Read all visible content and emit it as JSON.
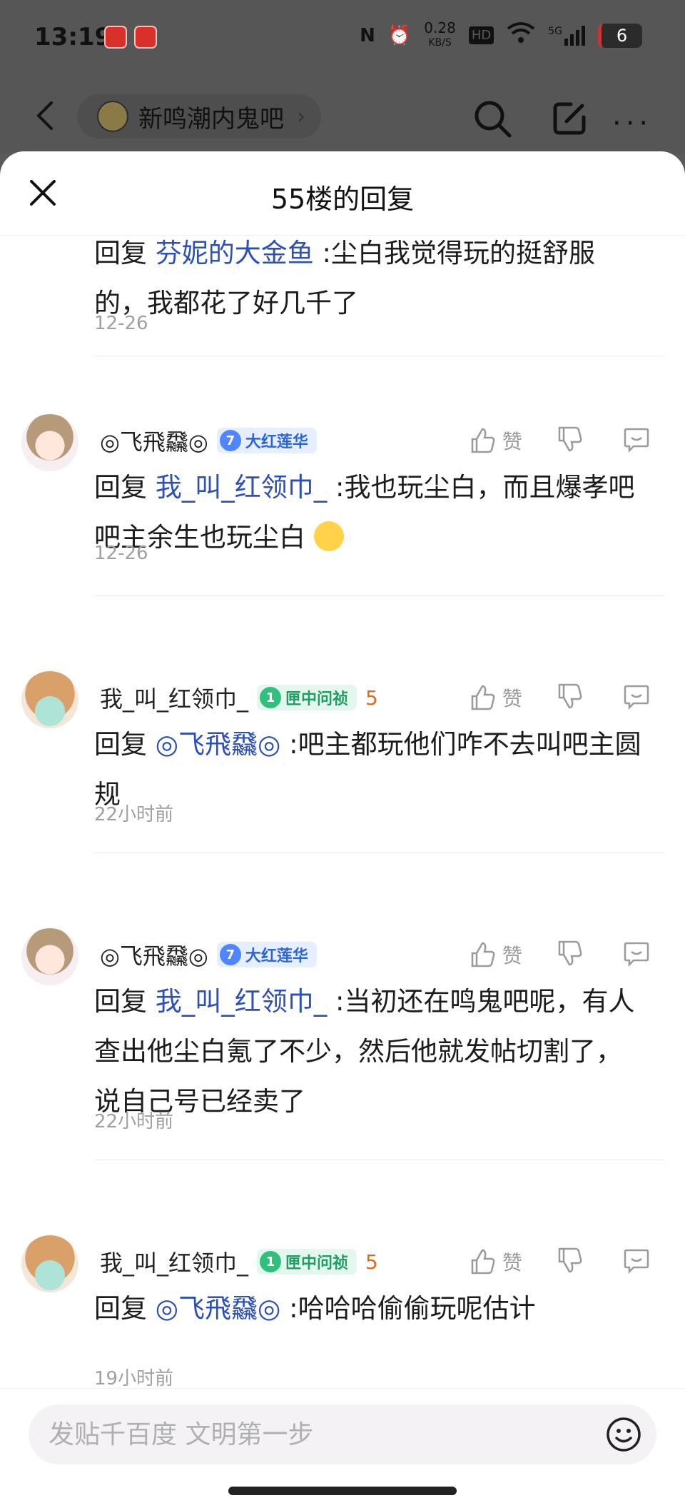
{
  "status_bar": {
    "time": "13:19",
    "net_speed": "0.28",
    "net_unit": "KB/S",
    "hd": "HD",
    "signal_label": "5G",
    "battery": "6"
  },
  "top_nav": {
    "forum_name": "新鸣潮内鬼吧"
  },
  "sheet": {
    "title": "55楼的回复"
  },
  "replies": [
    {
      "prefix": "回复",
      "mention": "芬妮的大金鱼",
      "text": " :尘白我觉得玩的挺舒服的，我都花了好几千了",
      "date": "12-26"
    },
    {
      "username": "◎飞飛飝◎",
      "badge_level": "7",
      "badge_title": "大红莲华",
      "like_label": "赞",
      "prefix": "回复",
      "mention": "我_叫_红领巾_",
      "text": " :我也玩尘白，而且爆孝吧吧主余生也玩尘白",
      "date": "12-26"
    },
    {
      "username": "我_叫_红领巾_",
      "badge_level": "1",
      "badge_title": "匣中问祯",
      "extra_badge": "5",
      "like_label": "赞",
      "prefix": "回复",
      "mention": "◎飞飛飝◎",
      "text": " :吧主都玩他们咋不去叫吧主圆规",
      "date": "22小时前"
    },
    {
      "username": "◎飞飛飝◎",
      "badge_level": "7",
      "badge_title": "大红莲华",
      "like_label": "赞",
      "prefix": "回复",
      "mention": "我_叫_红领巾_",
      "text": " :当初还在鸣鬼吧呢，有人查出他尘白氪了不少，然后他就发帖切割了，说自己号已经卖了",
      "date": "22小时前"
    },
    {
      "username": "我_叫_红领巾_",
      "badge_level": "1",
      "badge_title": "匣中问祯",
      "extra_badge": "5",
      "like_label": "赞",
      "prefix": "回复",
      "mention": "◎飞飛飝◎",
      "text": " :哈哈哈偷偷玩呢估计",
      "date": "19小时前"
    }
  ],
  "input": {
    "placeholder": "发贴千百度 文明第一步"
  },
  "colors": {
    "mention": "#2c50b8",
    "badge_blue": "#2b63e0",
    "badge_green": "#1f9d62",
    "date_gray": "#a0a0a0"
  }
}
